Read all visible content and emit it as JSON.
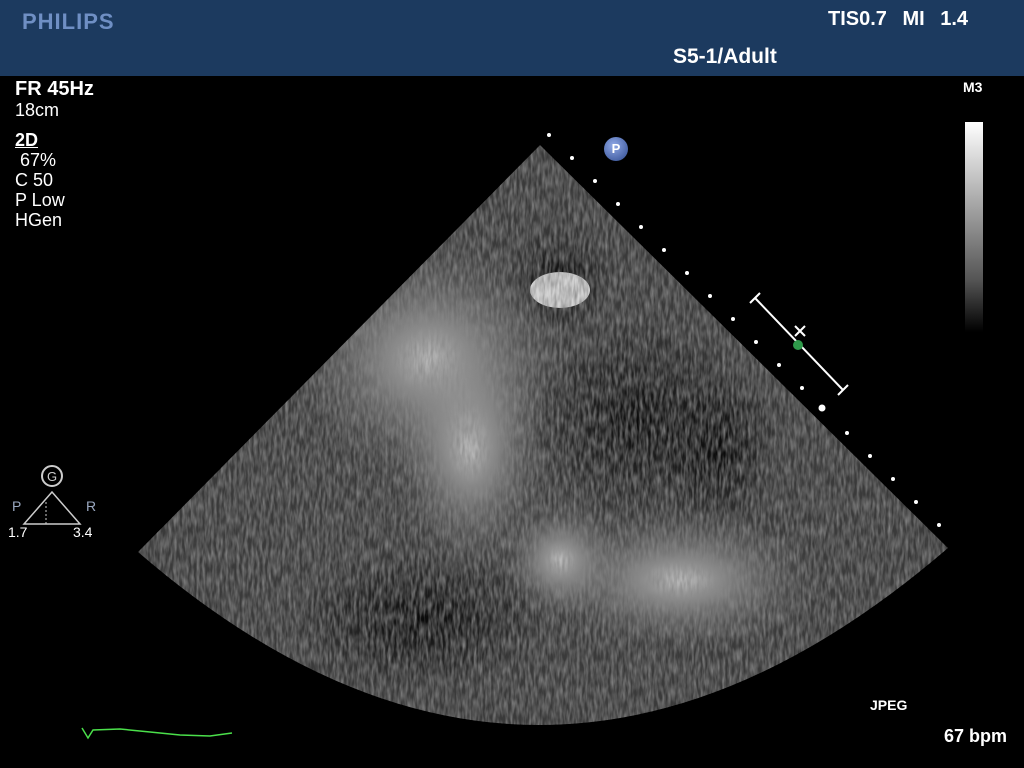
{
  "header": {
    "brand": "PHILIPS",
    "tis_mi": "TIS0.7 MI 1.4",
    "probe": "S5-1/Adult"
  },
  "params": {
    "frame_rate": "FR 45Hz",
    "depth": "18cm",
    "mode": "2D",
    "gain": "67%",
    "compress": "C 50",
    "power": "P Low",
    "freq": "HGen"
  },
  "gray_map": {
    "label": "M3"
  },
  "focus": {
    "glyph": "G",
    "left_label": "P",
    "right_label": "R",
    "left_value": "1.7",
    "right_value": "3.4"
  },
  "probe_marker": "P",
  "format": "JPEG",
  "heart_rate": "67 bpm",
  "colors": {
    "header_bg": "#1c3a5f",
    "brand": "#6f8fc4",
    "ecg": "#4be04b",
    "caliper_dot": "#2e9a4a"
  },
  "icons": [
    "probe-orientation-icon",
    "focus-triangle-icon",
    "caliper-icon",
    "ecg-trace"
  ]
}
